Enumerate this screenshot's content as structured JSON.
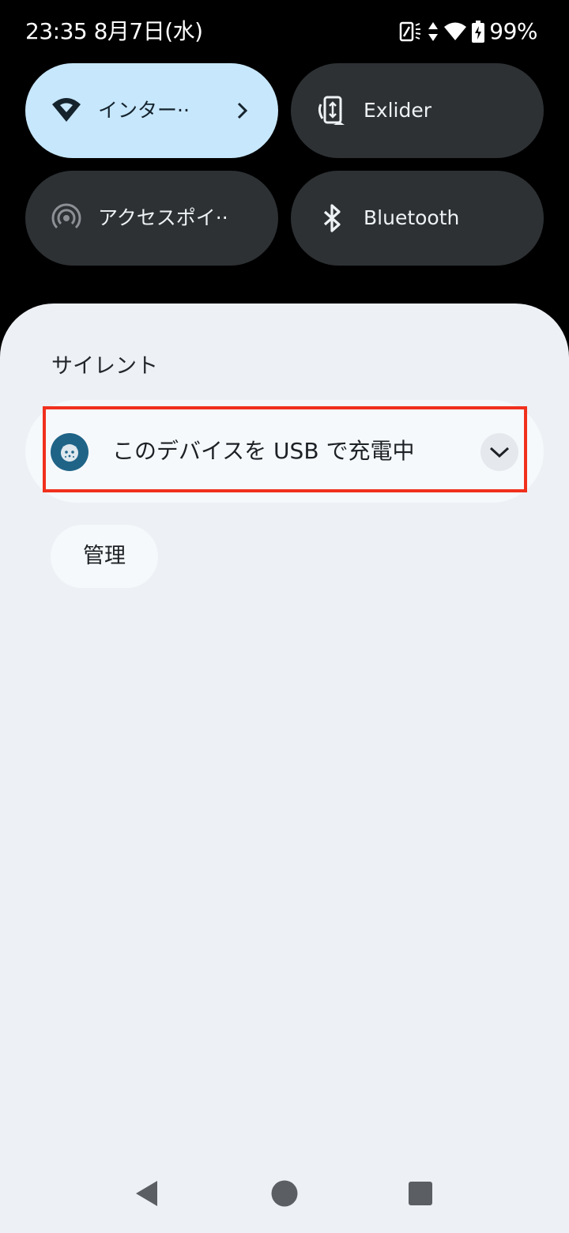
{
  "status_bar": {
    "time": "23:35 8月7日(水)",
    "battery_percent": "99%",
    "icons": [
      "vibrate-icon",
      "data-activity-icon",
      "wifi-icon",
      "battery-charging-icon"
    ]
  },
  "quick_settings": {
    "tiles": [
      {
        "label": "インター··",
        "icon": "wifi-icon",
        "state": "active",
        "has_chevron": true
      },
      {
        "label": "Exlider",
        "icon": "screen-rotate-icon",
        "state": "inactive"
      },
      {
        "label": "アクセスポイ··",
        "icon": "hotspot-icon",
        "state": "inactive"
      },
      {
        "label": "Bluetooth",
        "icon": "bluetooth-icon",
        "state": "inactive"
      }
    ]
  },
  "notifications": {
    "section_header": "サイレント",
    "items": [
      {
        "title": "このデバイスを USB で充電中",
        "app_icon": "android-system-icon",
        "expand_icon": "chevron-down-icon"
      }
    ],
    "manage_label": "管理"
  },
  "navigation_bar": {
    "buttons": [
      "back-icon",
      "home-icon",
      "recents-icon"
    ]
  },
  "colors": {
    "active_tile": "#c7e7fc",
    "inactive_tile": "#2d3134",
    "shade_background": "#edf0f4",
    "notification_background": "#f6f9fc",
    "highlight_border": "#f0301d",
    "app_icon_background": "#1f6487"
  }
}
